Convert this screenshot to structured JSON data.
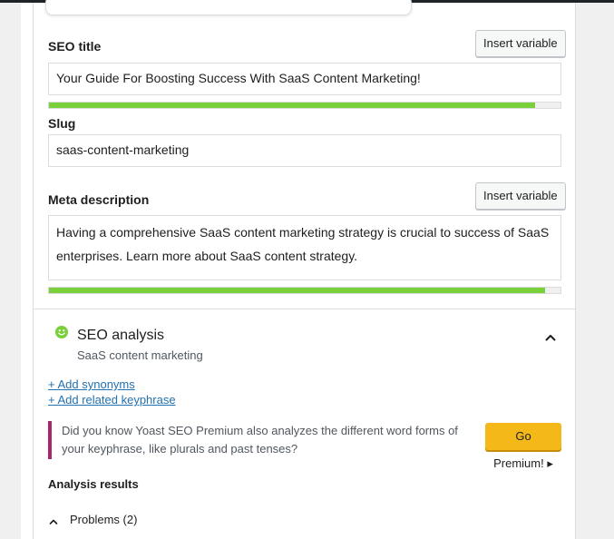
{
  "seo_title": {
    "label": "SEO title",
    "insert_variable": "Insert variable",
    "value": "Your Guide For Boosting Success With SaaS Content Marketing!",
    "progress_fraction": 0.95,
    "progress_color": "#7ad03a"
  },
  "slug": {
    "label": "Slug",
    "value": "saas-content-marketing"
  },
  "meta_description": {
    "label": "Meta description",
    "insert_variable": "Insert variable",
    "value": "Having a comprehensive SaaS content marketing strategy is crucial to success of SaaS enterprises. Learn more about SaaS content strategy.",
    "progress_fraction": 0.97,
    "progress_color": "#7ad03a"
  },
  "seo_analysis": {
    "title": "SEO analysis",
    "keyphrase": "SaaS content marketing",
    "status_color": "#7ad03a",
    "status_icon": "smiley-icon",
    "collapse_icon": "chevron-up-icon"
  },
  "links": {
    "add_synonyms": "+ Add synonyms",
    "add_related": "+ Add related keyphrase"
  },
  "premium_notice": {
    "text": "Did you know Yoast SEO Premium also analyzes the different word forms of your keyphrase, like plurals and past tenses?",
    "button": "Go Premium! ▸",
    "accent_color": "#a4286a",
    "button_color": "#f4b919"
  },
  "analysis_results": {
    "heading": "Analysis results",
    "problems_label": "Problems (2)"
  }
}
